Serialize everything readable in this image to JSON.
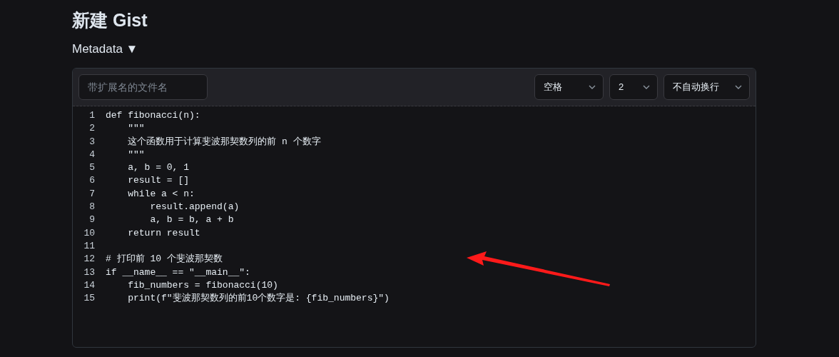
{
  "title": "新建 Gist",
  "metadata_toggle": {
    "label": "Metadata ▼"
  },
  "filename_field": {
    "placeholder": "带扩展名的文件名"
  },
  "selects": [
    {
      "value": "空格"
    },
    {
      "value": "2"
    },
    {
      "value": "不自动换行"
    }
  ],
  "code_lines": [
    {
      "number": "1",
      "text": "def fibonacci(n):"
    },
    {
      "number": "2",
      "text": "    \"\"\""
    },
    {
      "number": "3",
      "text": "    这个函数用于计算斐波那契数列的前 n 个数字"
    },
    {
      "number": "4",
      "text": "    \"\"\""
    },
    {
      "number": "5",
      "text": "    a, b = 0, 1"
    },
    {
      "number": "6",
      "text": "    result = []"
    },
    {
      "number": "7",
      "text": "    while a < n:"
    },
    {
      "number": "8",
      "text": "        result.append(a)"
    },
    {
      "number": "9",
      "text": "        a, b = b, a + b"
    },
    {
      "number": "10",
      "text": "    return result"
    },
    {
      "number": "11"
    },
    {
      "number": "12",
      "text": "# 打印前 10 个斐波那契数"
    },
    {
      "number": "13",
      "text": "if __name__ == \"__main__\":"
    },
    {
      "number": "14",
      "text": "    fib_numbers = fibonacci(10)"
    },
    {
      "number": "15",
      "text": "    print(f\"斐波那契数列的前10个数字是: {fib_numbers}\")"
    }
  ]
}
